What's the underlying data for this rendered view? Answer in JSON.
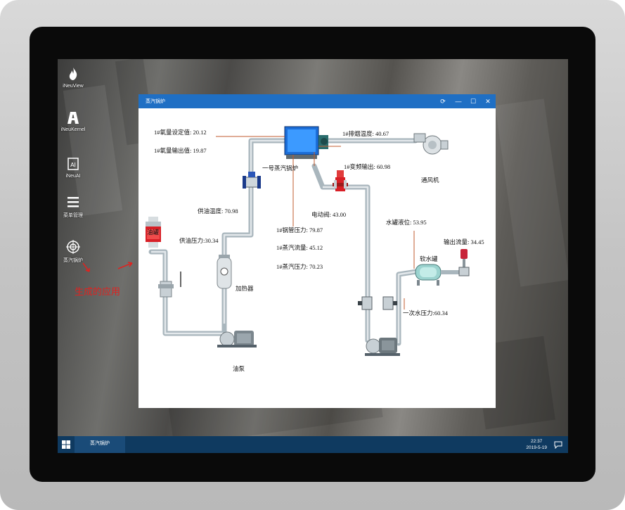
{
  "desktop": {
    "icons": [
      {
        "label": "iNeuView",
        "icon": "flame-icon"
      },
      {
        "label": "iNeuKernel",
        "icon": "kernel-icon"
      },
      {
        "label": "iNeuAI",
        "icon": "ai-icon"
      },
      {
        "label": "菜单管理",
        "icon": "menu-icon"
      },
      {
        "label": "蒸汽锅炉",
        "icon": "target-icon"
      }
    ],
    "annotation": "生成的应用",
    "accent_red": "#e0221f"
  },
  "window": {
    "title": "蒸汽锅炉",
    "buttons": {
      "refresh": "⟳",
      "minimize": "—",
      "maximize": "☐",
      "close": "✕"
    },
    "title_color": "#1f6fc4"
  },
  "diagram": {
    "o2_setpoint": "1#氧量设定值: 20.12",
    "o2_output": "1#氧量输出值: 19.87",
    "boiler_label": "一号蒸汽锅炉",
    "exhaust_temp": "1#排烟温度: 40.67",
    "vfd_output": "1#变频输出: 60.98",
    "fan_label": "通风机",
    "oil_supply_temp": "供油温度: 70.98",
    "oil_tank_label": "油罐",
    "oil_supply_pressure": "供油压力:30.34",
    "heater_label": "加热器",
    "oil_pump_label": "油泵",
    "electric_valve": "电动阀: 43.00",
    "drum_pressure": "1#锅管压力: 79.87",
    "steam_flow": "1#蒸汽流量: 45.12",
    "steam_pressure": "1#蒸汽压力: 70.23",
    "tank_level": "水罐液位: 53.95",
    "output_flow": "输出流量: 34.45",
    "soft_water_tank_label": "软水罐",
    "primary_water_pressure": "一次水压力:60.34"
  },
  "taskbar": {
    "task_label": "蒸汽锅炉",
    "time": "22:37",
    "date": "2019-5-19",
    "color": "#0f3a60"
  }
}
